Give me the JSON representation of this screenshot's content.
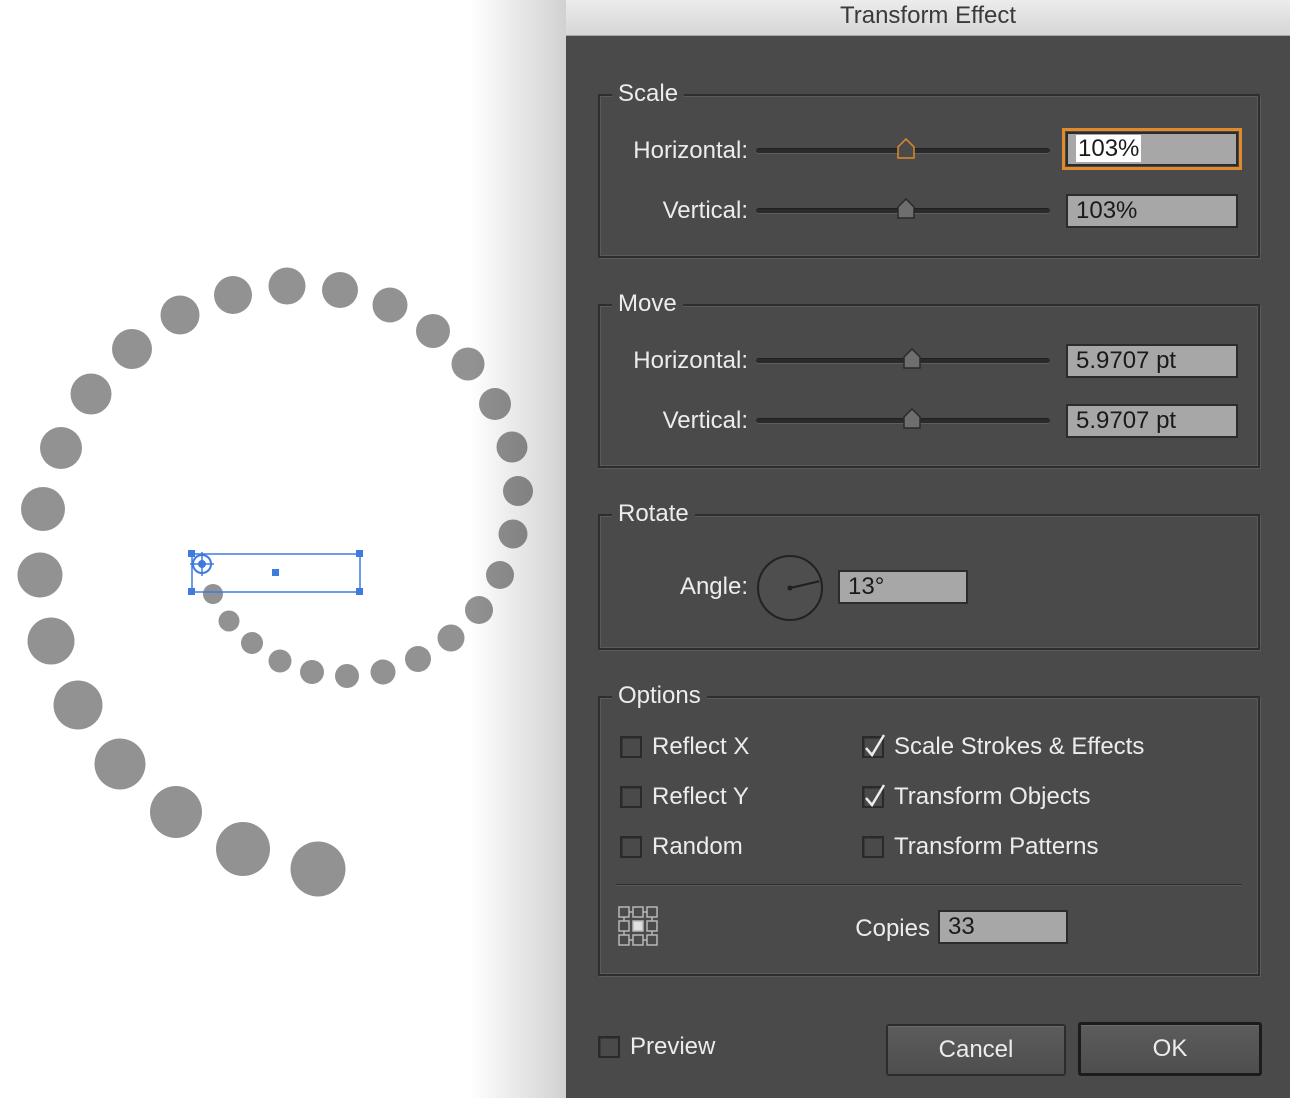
{
  "dialog": {
    "title": "Transform Effect",
    "scale": {
      "legend": "Scale",
      "horizontal_label": "Horizontal:",
      "horizontal_value": "103%",
      "horizontal_slider_fraction": 0.51,
      "vertical_label": "Vertical:",
      "vertical_value": "103%",
      "vertical_slider_fraction": 0.51
    },
    "move": {
      "legend": "Move",
      "horizontal_label": "Horizontal:",
      "horizontal_value": "5.9707 pt",
      "horizontal_slider_fraction": 0.53,
      "vertical_label": "Vertical:",
      "vertical_value": "5.9707 pt",
      "vertical_slider_fraction": 0.53
    },
    "rotate": {
      "legend": "Rotate",
      "angle_label": "Angle:",
      "angle_value": "13°",
      "angle_degrees": 13
    },
    "options": {
      "legend": "Options",
      "reflect_x": {
        "label": "Reflect X",
        "checked": false
      },
      "reflect_y": {
        "label": "Reflect Y",
        "checked": false
      },
      "random": {
        "label": "Random",
        "checked": false
      },
      "scale_strokes": {
        "label": "Scale Strokes & Effects",
        "checked": true
      },
      "transform_objects": {
        "label": "Transform Objects",
        "checked": true
      },
      "transform_patterns": {
        "label": "Transform Patterns",
        "checked": false
      },
      "copies_label": "Copies",
      "copies_value": "33",
      "reference_point_icon": "reference-point-locator-icon"
    },
    "preview": {
      "label": "Preview",
      "checked": false
    },
    "cancel_label": "Cancel",
    "ok_label": "OK"
  },
  "colors": {
    "dialog_bg": "#4a4a4a",
    "field_bg": "#a7a7a7",
    "focus_ring": "#e08a2c",
    "dot_fill": "#929292",
    "selection_blue": "#3d7be0"
  },
  "artboard": {
    "dot_count": 33
  }
}
